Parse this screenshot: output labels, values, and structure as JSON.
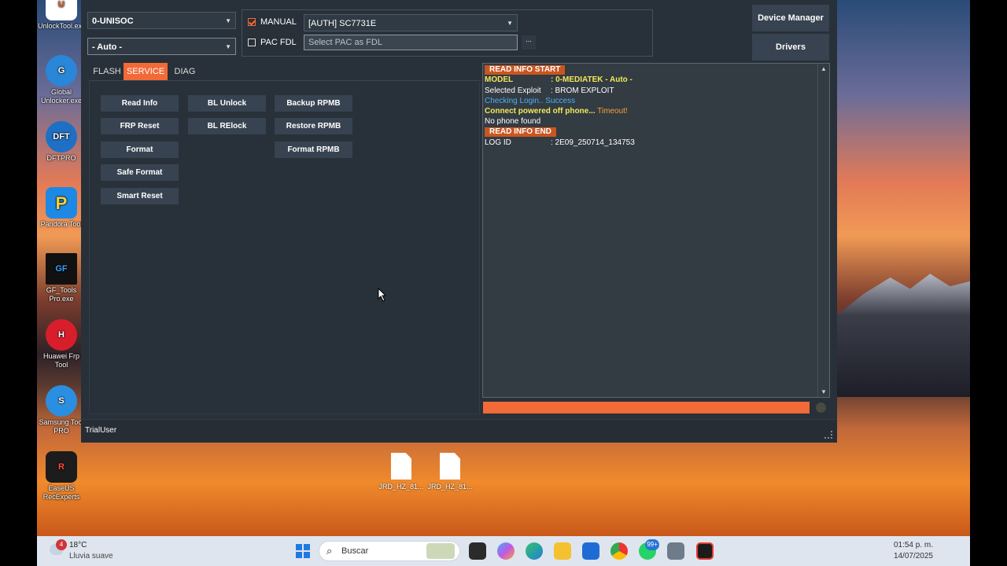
{
  "desktop": {
    "icons": [
      {
        "label": "UnlockTool.exe",
        "abbr": "U"
      },
      {
        "label": "Global Unlocker.exe",
        "abbr": "G"
      },
      {
        "label": "DFTPRO",
        "abbr": "DFT"
      },
      {
        "label": "Pandora Tool",
        "abbr": "P"
      },
      {
        "label": "GF_Tools Pro.exe",
        "abbr": "GF"
      },
      {
        "label": "Huawei Frp Tool",
        "abbr": "H"
      },
      {
        "label": "Samsung Tool PRO",
        "abbr": "S"
      },
      {
        "label": "EaseUS RecExperts",
        "abbr": "R"
      }
    ],
    "files": [
      {
        "label": "JRD_HZ_81..."
      },
      {
        "label": "JRD_HZ_81..."
      }
    ]
  },
  "app": {
    "platform_select": "0-UNISOC",
    "mode_select": "- Auto -",
    "manual_label": "MANUAL",
    "manual_checked": true,
    "auth_select": "[AUTH] SC7731E",
    "pac_label": "PAC FDL",
    "pac_checked": false,
    "pac_placeholder": "Select PAC as FDL",
    "browse_label": "...",
    "device_manager": "Device Manager",
    "drivers": "Drivers",
    "tabs": [
      {
        "label": "FLASH",
        "active": false
      },
      {
        "label": "SERVICE",
        "active": true
      },
      {
        "label": "DIAG",
        "active": false
      }
    ],
    "buttons": {
      "read_info": "Read Info",
      "frp_reset": "FRP Reset",
      "format": "Format",
      "safe_format": "Safe Format",
      "smart_reset": "Smart Reset",
      "bl_unlock": "BL Unlock",
      "bl_relock": "BL RElock",
      "backup_rpmb": "Backup RPMB",
      "restore_rpmb": "Restore RPMB",
      "format_rpmb": "Format RPMB"
    },
    "log": {
      "start": "READ INFO START",
      "model_key": "MODEL",
      "model_val": ": 0-MEDIATEK - Auto -",
      "exploit_key": "Selected Exploit",
      "exploit_val": ": BROM EXPLOIT",
      "checking": "Checking Login.. Success",
      "connect": "Connect powered off phone...",
      "timeout": "Timeout!",
      "no_phone": "No phone found",
      "end": "READ INFO END",
      "logid_key": "LOG ID",
      "logid_val": ": 2E09_250714_134753"
    },
    "progress": 1.0,
    "status_user": "TrialUser"
  },
  "taskbar": {
    "weather_temp": "18°C",
    "weather_desc": "Lluvia suave",
    "weather_badge": "4",
    "search_placeholder": "Buscar",
    "whatsapp_badge": "99+",
    "time": "01:54 p. m.",
    "date": "14/07/2025"
  },
  "colors": {
    "accent": "#f26a37",
    "window_bg": "#283039",
    "log_bg": "#333b43"
  }
}
